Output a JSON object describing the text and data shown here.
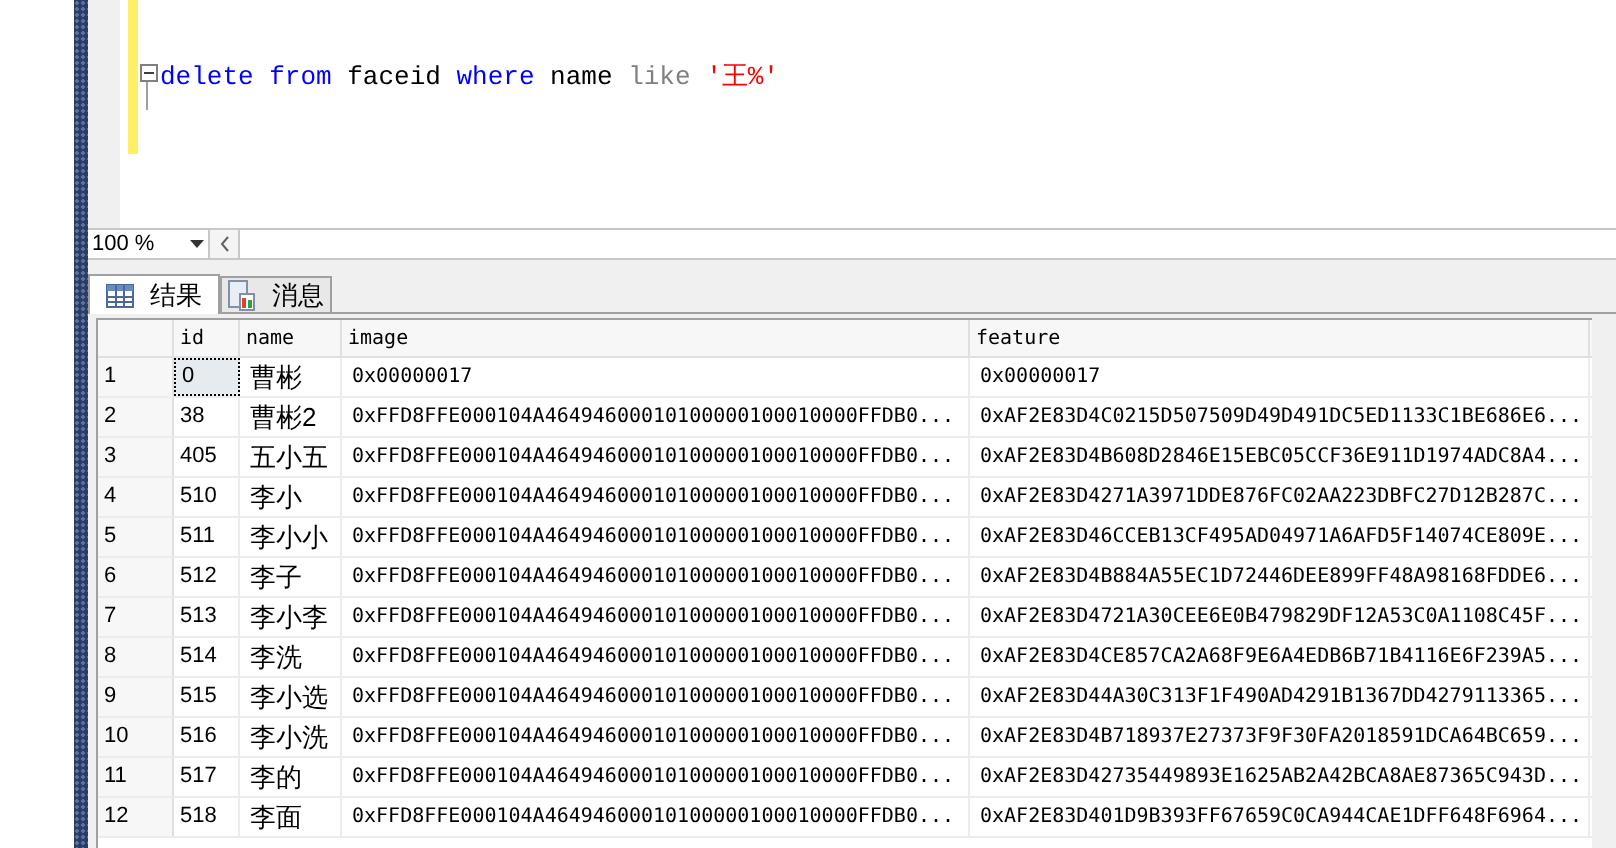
{
  "editor": {
    "code": [
      {
        "kind": "keyword",
        "text": "delete"
      },
      {
        "kind": "keyword",
        "text": "from"
      },
      {
        "kind": "plain",
        "text": "faceid"
      },
      {
        "kind": "keyword",
        "text": "where"
      },
      {
        "kind": "plain",
        "text": "name"
      },
      {
        "kind": "operator",
        "text": "like"
      },
      {
        "kind": "string",
        "text": "'王%'"
      }
    ]
  },
  "zoom": {
    "value": "100 %"
  },
  "tabs": [
    {
      "label": "结果",
      "selected": true,
      "kind": "grid"
    },
    {
      "label": "消息",
      "selected": false,
      "kind": "messages"
    }
  ],
  "table": {
    "columns": [
      "id",
      "name",
      "image",
      "feature"
    ],
    "rows": [
      {
        "row": "1",
        "id": "0",
        "name": "曹彬",
        "image": "0x00000017",
        "feature": "0x00000017",
        "focused": true
      },
      {
        "row": "2",
        "id": "38",
        "name": "曹彬2",
        "image": "0xFFD8FFE000104A46494600010100000100010000FFDB0...",
        "feature": "0xAF2E83D4C0215D507509D49D491DC5ED1133C1BE686E6...",
        "focused": false
      },
      {
        "row": "3",
        "id": "405",
        "name": "五小五",
        "image": "0xFFD8FFE000104A46494600010100000100010000FFDB0...",
        "feature": "0xAF2E83D4B608D2846E15EBC05CCF36E911D1974ADC8A4...",
        "focused": false
      },
      {
        "row": "4",
        "id": "510",
        "name": "李小",
        "image": "0xFFD8FFE000104A46494600010100000100010000FFDB0...",
        "feature": "0xAF2E83D4271A3971DDE876FC02AA223DBFC27D12B287C...",
        "focused": false
      },
      {
        "row": "5",
        "id": "511",
        "name": "李小小",
        "image": "0xFFD8FFE000104A46494600010100000100010000FFDB0...",
        "feature": "0xAF2E83D46CCEB13CF495AD04971A6AFD5F14074CE809E...",
        "focused": false
      },
      {
        "row": "6",
        "id": "512",
        "name": "李子",
        "image": "0xFFD8FFE000104A46494600010100000100010000FFDB0...",
        "feature": "0xAF2E83D4B884A55EC1D72446DEE899FF48A98168FDDE6...",
        "focused": false
      },
      {
        "row": "7",
        "id": "513",
        "name": "李小李",
        "image": "0xFFD8FFE000104A46494600010100000100010000FFDB0...",
        "feature": "0xAF2E83D4721A30CEE6E0B479829DF12A53C0A1108C45F...",
        "focused": false
      },
      {
        "row": "8",
        "id": "514",
        "name": "李洗",
        "image": "0xFFD8FFE000104A46494600010100000100010000FFDB0...",
        "feature": "0xAF2E83D4CE857CA2A68F9E6A4EDB6B71B4116E6F239A5...",
        "focused": false
      },
      {
        "row": "9",
        "id": "515",
        "name": "李小选",
        "image": "0xFFD8FFE000104A46494600010100000100010000FFDB0...",
        "feature": "0xAF2E83D44A30C313F1F490AD4291B1367DD4279113365...",
        "focused": false
      },
      {
        "row": "10",
        "id": "516",
        "name": "李小洗",
        "image": "0xFFD8FFE000104A46494600010100000100010000FFDB0...",
        "feature": "0xAF2E83D4B718937E27373F9F30FA2018591DCA64BC659...",
        "focused": false
      },
      {
        "row": "11",
        "id": "517",
        "name": "李的",
        "image": "0xFFD8FFE000104A46494600010100000100010000FFDB0...",
        "feature": "0xAF2E83D42735449893E1625AB2A42BCA8AE87365C943D...",
        "focused": false
      },
      {
        "row": "12",
        "id": "518",
        "name": "李面",
        "image": "0xFFD8FFE000104A46494600010100000100010000FFDB0...",
        "feature": "0xAF2E83D401D9B393FF67659C0CA944CAE1DFF648F6964...",
        "focused": false
      }
    ]
  }
}
